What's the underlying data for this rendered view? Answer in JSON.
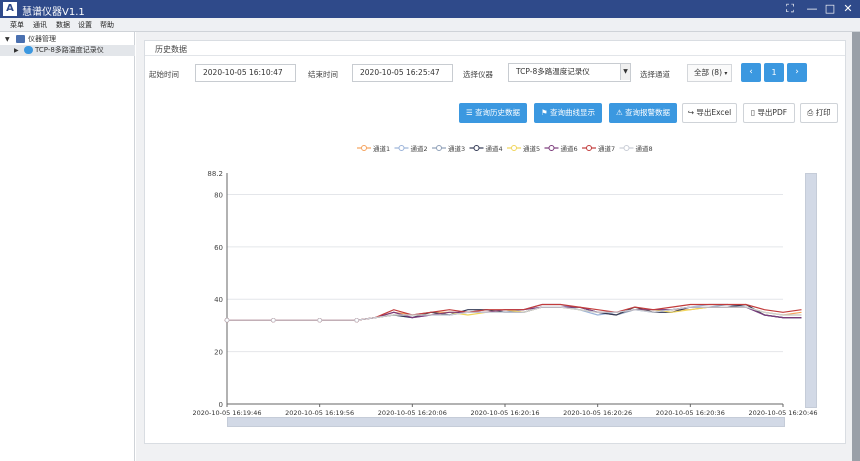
{
  "window": {
    "title": "慧谱仪器V1.1",
    "logo": "A"
  },
  "menu": [
    "菜单",
    "通讯",
    "数据",
    "设置",
    "帮助"
  ],
  "tree": {
    "root": "仪器管理",
    "child": "TCP-8多路温度记录仪"
  },
  "panel": {
    "title": "历史数据"
  },
  "filters": {
    "start_label": "起始时间",
    "start_value": "2020-10-05 16:10:47",
    "end_label": "结束时间",
    "end_value": "2020-10-05 16:25:47",
    "device_label": "选择仪器",
    "device_value": "TCP-8多路温度记录仪",
    "channel_label": "选择通道",
    "channel_value": "全部 (8)",
    "page_value": "1"
  },
  "actions": {
    "query_history": "查询历史数据",
    "query_curve": "查询曲线显示",
    "query_alarm": "查询报警数据",
    "export_excel": "导出Excel",
    "export_pdf": "导出PDF",
    "print": "打印"
  },
  "chart_data": {
    "type": "line",
    "ylim": [
      0,
      88.2
    ],
    "y_ticks": [
      0,
      20,
      40,
      60,
      80
    ],
    "y_max_label": "88.2",
    "x_tick_labels": [
      "2020-10-05 16:19:46",
      "2020-10-05 16:19:56",
      "2020-10-05 16:20:06",
      "2020-10-05 16:20:16",
      "2020-10-05 16:20:26",
      "2020-10-05 16:20:36",
      "2020-10-05 16:20:46"
    ],
    "x_ticks_sec": [
      0,
      10,
      20,
      30,
      40,
      50,
      60
    ],
    "grid": true,
    "legend": "top-center",
    "series": [
      {
        "name": "通道1",
        "color": "#f5a25d",
        "values": [
          [
            0,
            32
          ],
          [
            5,
            32
          ],
          [
            10,
            32
          ],
          [
            14,
            32
          ],
          [
            16,
            33
          ],
          [
            18,
            35
          ],
          [
            20,
            34
          ],
          [
            22,
            35
          ],
          [
            24,
            35
          ],
          [
            26,
            35
          ],
          [
            28,
            35
          ],
          [
            30,
            36
          ],
          [
            32,
            35
          ],
          [
            34,
            37
          ],
          [
            36,
            37
          ],
          [
            38,
            37
          ],
          [
            40,
            35
          ],
          [
            42,
            34
          ],
          [
            44,
            37
          ],
          [
            46,
            35
          ],
          [
            48,
            36
          ],
          [
            50,
            36
          ],
          [
            52,
            37
          ],
          [
            54,
            37
          ],
          [
            56,
            37
          ],
          [
            58,
            35
          ],
          [
            60,
            34
          ],
          [
            62,
            35
          ]
        ]
      },
      {
        "name": "通道2",
        "color": "#9bb3d9",
        "values": [
          [
            0,
            32
          ],
          [
            5,
            32
          ],
          [
            10,
            32
          ],
          [
            14,
            32
          ],
          [
            16,
            33
          ],
          [
            18,
            34
          ],
          [
            20,
            33
          ],
          [
            22,
            34
          ],
          [
            24,
            34
          ],
          [
            26,
            35
          ],
          [
            28,
            36
          ],
          [
            30,
            35
          ],
          [
            32,
            36
          ],
          [
            34,
            38
          ],
          [
            36,
            38
          ],
          [
            38,
            36
          ],
          [
            40,
            34
          ],
          [
            42,
            35
          ],
          [
            44,
            36
          ],
          [
            46,
            36
          ],
          [
            48,
            36
          ],
          [
            50,
            37
          ],
          [
            52,
            38
          ],
          [
            54,
            38
          ],
          [
            56,
            37
          ],
          [
            58,
            34
          ],
          [
            60,
            33
          ],
          [
            62,
            33
          ]
        ]
      },
      {
        "name": "通道3",
        "color": "#8fa0b8",
        "values": [
          [
            0,
            32
          ],
          [
            5,
            32
          ],
          [
            10,
            32
          ],
          [
            14,
            32
          ],
          [
            16,
            33
          ],
          [
            18,
            34
          ],
          [
            20,
            34
          ],
          [
            22,
            35
          ],
          [
            24,
            34
          ],
          [
            26,
            35
          ],
          [
            28,
            36
          ],
          [
            30,
            35
          ],
          [
            32,
            35
          ],
          [
            34,
            37
          ],
          [
            36,
            37
          ],
          [
            38,
            36
          ],
          [
            40,
            35
          ],
          [
            42,
            34
          ],
          [
            44,
            36
          ],
          [
            46,
            35
          ],
          [
            48,
            36
          ],
          [
            50,
            37
          ],
          [
            52,
            37
          ],
          [
            54,
            38
          ],
          [
            56,
            37
          ],
          [
            58,
            34
          ],
          [
            60,
            33
          ],
          [
            62,
            33
          ]
        ]
      },
      {
        "name": "通道4",
        "color": "#333a55",
        "values": [
          [
            0,
            32
          ],
          [
            5,
            32
          ],
          [
            10,
            32
          ],
          [
            14,
            32
          ],
          [
            16,
            33
          ],
          [
            18,
            34
          ],
          [
            20,
            33
          ],
          [
            22,
            35
          ],
          [
            24,
            34
          ],
          [
            26,
            36
          ],
          [
            28,
            36
          ],
          [
            30,
            35
          ],
          [
            32,
            35
          ],
          [
            34,
            37
          ],
          [
            36,
            37
          ],
          [
            38,
            37
          ],
          [
            40,
            35
          ],
          [
            42,
            34
          ],
          [
            44,
            37
          ],
          [
            46,
            35
          ],
          [
            48,
            35
          ],
          [
            50,
            37
          ],
          [
            52,
            37
          ],
          [
            54,
            37
          ],
          [
            56,
            38
          ],
          [
            58,
            34
          ],
          [
            60,
            33
          ],
          [
            62,
            33
          ]
        ]
      },
      {
        "name": "通道5",
        "color": "#f0d55a",
        "values": [
          [
            0,
            32
          ],
          [
            5,
            32
          ],
          [
            10,
            32
          ],
          [
            14,
            32
          ],
          [
            16,
            33
          ],
          [
            18,
            34
          ],
          [
            20,
            34
          ],
          [
            22,
            34
          ],
          [
            24,
            35
          ],
          [
            26,
            34
          ],
          [
            28,
            35
          ],
          [
            30,
            36
          ],
          [
            32,
            35
          ],
          [
            34,
            37
          ],
          [
            36,
            37
          ],
          [
            38,
            36
          ],
          [
            40,
            35
          ],
          [
            42,
            35
          ],
          [
            44,
            36
          ],
          [
            46,
            36
          ],
          [
            48,
            35
          ],
          [
            50,
            36
          ],
          [
            52,
            37
          ],
          [
            54,
            37
          ],
          [
            56,
            37
          ],
          [
            58,
            35
          ],
          [
            60,
            34
          ],
          [
            62,
            34
          ]
        ]
      },
      {
        "name": "通道6",
        "color": "#7b3a7a",
        "values": [
          [
            0,
            32
          ],
          [
            5,
            32
          ],
          [
            10,
            32
          ],
          [
            14,
            32
          ],
          [
            16,
            33
          ],
          [
            18,
            35
          ],
          [
            20,
            33
          ],
          [
            22,
            34
          ],
          [
            24,
            35
          ],
          [
            26,
            35
          ],
          [
            28,
            35
          ],
          [
            30,
            36
          ],
          [
            32,
            36
          ],
          [
            34,
            37
          ],
          [
            36,
            37
          ],
          [
            38,
            37
          ],
          [
            40,
            35
          ],
          [
            42,
            35
          ],
          [
            44,
            36
          ],
          [
            46,
            36
          ],
          [
            48,
            36
          ],
          [
            50,
            37
          ],
          [
            52,
            37
          ],
          [
            54,
            37
          ],
          [
            56,
            37
          ],
          [
            58,
            34
          ],
          [
            60,
            33
          ],
          [
            62,
            33
          ]
        ]
      },
      {
        "name": "通道7",
        "color": "#c23b3b",
        "values": [
          [
            0,
            32
          ],
          [
            5,
            32
          ],
          [
            10,
            32
          ],
          [
            14,
            32
          ],
          [
            16,
            33
          ],
          [
            18,
            36
          ],
          [
            20,
            34
          ],
          [
            22,
            35
          ],
          [
            24,
            36
          ],
          [
            26,
            35
          ],
          [
            28,
            36
          ],
          [
            30,
            36
          ],
          [
            32,
            36
          ],
          [
            34,
            38
          ],
          [
            36,
            38
          ],
          [
            38,
            37
          ],
          [
            40,
            36
          ],
          [
            42,
            35
          ],
          [
            44,
            37
          ],
          [
            46,
            36
          ],
          [
            48,
            37
          ],
          [
            50,
            38
          ],
          [
            52,
            38
          ],
          [
            54,
            38
          ],
          [
            56,
            38
          ],
          [
            58,
            36
          ],
          [
            60,
            35
          ],
          [
            62,
            36
          ]
        ]
      },
      {
        "name": "通道8",
        "color": "#c9cdd6",
        "values": [
          [
            0,
            32
          ],
          [
            5,
            32
          ],
          [
            10,
            32
          ],
          [
            14,
            32
          ],
          [
            16,
            33
          ],
          [
            18,
            34
          ],
          [
            20,
            34
          ],
          [
            22,
            34
          ],
          [
            24,
            34
          ],
          [
            26,
            35
          ],
          [
            28,
            35
          ],
          [
            30,
            35
          ],
          [
            32,
            35
          ],
          [
            34,
            37
          ],
          [
            36,
            37
          ],
          [
            38,
            36
          ],
          [
            40,
            35
          ],
          [
            42,
            35
          ],
          [
            44,
            36
          ],
          [
            46,
            35
          ],
          [
            48,
            36
          ],
          [
            50,
            37
          ],
          [
            52,
            37
          ],
          [
            54,
            37
          ],
          [
            56,
            37
          ],
          [
            58,
            35
          ],
          [
            60,
            34
          ],
          [
            62,
            34
          ]
        ]
      }
    ]
  }
}
